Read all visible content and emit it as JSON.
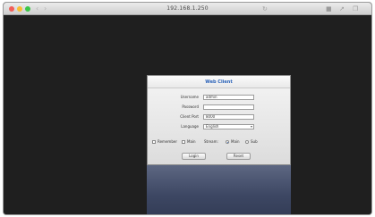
{
  "window": {
    "title": "192.168.1.250",
    "back_arrow": "‹",
    "forward_arrow": "›",
    "reload_glyph": "↻",
    "traffic_colors": [
      "#f25f58",
      "#f9be33",
      "#3bc648"
    ],
    "toolbar_icons": [
      {
        "name": "bookmark-icon",
        "glyph": "■"
      },
      {
        "name": "share-icon",
        "glyph": "↗"
      },
      {
        "name": "tabs-icon",
        "glyph": "❐"
      }
    ]
  },
  "login": {
    "title": "Web Client",
    "fields": [
      {
        "label": "Username",
        "value": "admin",
        "type": "text"
      },
      {
        "label": "Password",
        "value": "",
        "type": "password"
      },
      {
        "label": "Client Port",
        "value": "8000",
        "type": "text"
      },
      {
        "label": "Language",
        "value": "English",
        "type": "select"
      }
    ],
    "options": {
      "checkbox1_label": "Remember",
      "checkbox2_label": "Main",
      "radio_prefix": "Stream:",
      "radio_labels": [
        "Main",
        "Sub"
      ],
      "radio_selected": 0
    },
    "buttons": {
      "login_label": "Login",
      "reset_label": "Reset"
    }
  },
  "colors": {
    "desktop_bg": "#1f1f1f",
    "accent": "#2a62b8",
    "lower_panel": "#3d4763"
  }
}
